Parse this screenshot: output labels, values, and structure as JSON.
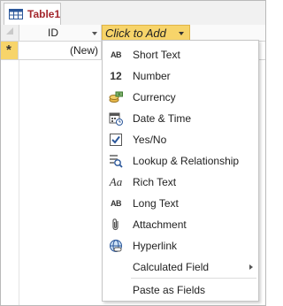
{
  "tab": {
    "label": "Table1"
  },
  "columns": {
    "id_header": "ID",
    "add_header": "Click to Add"
  },
  "new_record": {
    "marker": "*",
    "id_value": "(New)"
  },
  "menu": {
    "items": [
      {
        "label": "Short Text",
        "icon": "short-text-icon"
      },
      {
        "label": "Number",
        "icon": "number-icon"
      },
      {
        "label": "Currency",
        "icon": "currency-icon"
      },
      {
        "label": "Date & Time",
        "icon": "calendar-icon"
      },
      {
        "label": "Yes/No",
        "icon": "checkbox-icon"
      },
      {
        "label": "Lookup & Relationship",
        "icon": "lookup-icon"
      },
      {
        "label": "Rich Text",
        "icon": "rich-text-icon"
      },
      {
        "label": "Long Text",
        "icon": "long-text-icon"
      },
      {
        "label": "Attachment",
        "icon": "paperclip-icon"
      },
      {
        "label": "Hyperlink",
        "icon": "hyperlink-icon"
      },
      {
        "label": "Calculated Field",
        "icon": "none",
        "has_submenu": true
      },
      {
        "label": "Paste as Fields",
        "icon": "none"
      }
    ]
  },
  "icon_text": {
    "short_text": "AB",
    "number": "12",
    "rich_text": "Aa",
    "long_text": "AB"
  },
  "colors": {
    "tab_label": "#a4262c",
    "click_to_add_bg": "#f7d46a",
    "selector_bg": "#f7d46a"
  }
}
